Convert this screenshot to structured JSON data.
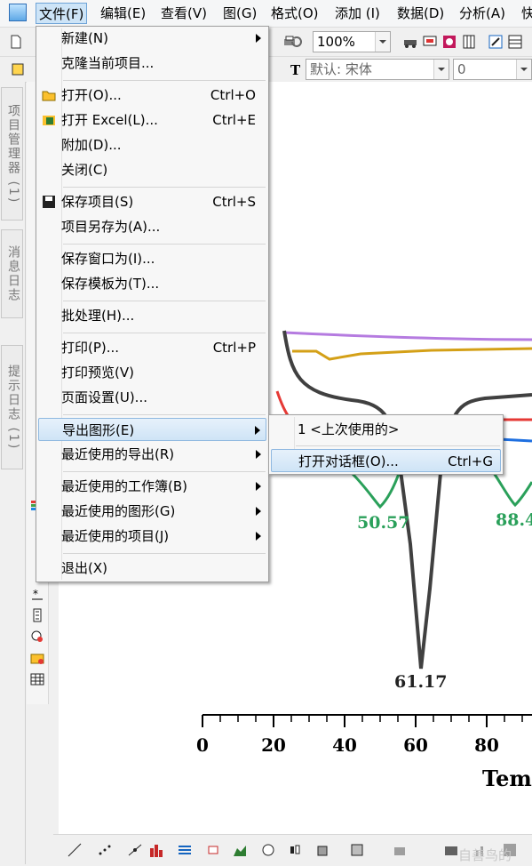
{
  "menubar": {
    "items": [
      "文件(F)",
      "编辑(E)",
      "查看(V)",
      "图(G)",
      "格式(O)",
      "添加 (I)",
      "数据(D)",
      "分析(A)",
      "快"
    ]
  },
  "toolbar1": {
    "zoom": "100%"
  },
  "toolbar2": {
    "font": "默认: 宋体",
    "size": "0"
  },
  "sidetabs": [
    "项目管理器 (1)",
    "消息日志",
    "提示日志 (1)"
  ],
  "file_menu": {
    "items": [
      {
        "label": "新建(N)",
        "shortcut": "",
        "submenu": true
      },
      {
        "label": "克隆当前项目...",
        "shortcut": "",
        "submenu": false
      },
      {
        "label": "打开(O)...",
        "shortcut": "Ctrl+O",
        "submenu": false
      },
      {
        "label": "打开 Excel(L)...",
        "shortcut": "Ctrl+E",
        "submenu": false
      },
      {
        "label": "附加(D)...",
        "shortcut": "",
        "submenu": false
      },
      {
        "label": "关闭(C)",
        "shortcut": "",
        "submenu": false
      },
      {
        "label": "保存项目(S)",
        "shortcut": "Ctrl+S",
        "submenu": false
      },
      {
        "label": "项目另存为(A)...",
        "shortcut": "",
        "submenu": false
      },
      {
        "label": "保存窗口为(I)...",
        "shortcut": "",
        "submenu": false
      },
      {
        "label": "保存模板为(T)...",
        "shortcut": "",
        "submenu": false
      },
      {
        "label": "批处理(H)...",
        "shortcut": "",
        "submenu": false
      },
      {
        "label": "打印(P)...",
        "shortcut": "Ctrl+P",
        "submenu": false
      },
      {
        "label": "打印预览(V)",
        "shortcut": "",
        "submenu": false
      },
      {
        "label": "页面设置(U)...",
        "shortcut": "",
        "submenu": false
      },
      {
        "label": "导出图形(E)",
        "shortcut": "",
        "submenu": true
      },
      {
        "label": "最近使用的导出(R)",
        "shortcut": "",
        "submenu": true
      },
      {
        "label": "最近使用的工作簿(B)",
        "shortcut": "",
        "submenu": true
      },
      {
        "label": "最近使用的图形(G)",
        "shortcut": "",
        "submenu": true
      },
      {
        "label": "最近使用的项目(J)",
        "shortcut": "",
        "submenu": true
      },
      {
        "label": "退出(X)",
        "shortcut": "",
        "submenu": false
      }
    ]
  },
  "export_submenu": {
    "items": [
      {
        "label": "1 <上次使用的>",
        "shortcut": ""
      },
      {
        "label": "打开对话框(O)...",
        "shortcut": "Ctrl+G"
      }
    ]
  },
  "chart_data": {
    "type": "line",
    "x_ticks": [
      "0",
      "20",
      "40",
      "60",
      "80"
    ],
    "xlabel": "Tem",
    "annotations": [
      "50.57",
      "61.17",
      "88.4"
    ],
    "colors": {
      "purple": "#b57be0",
      "gold": "#d4a017",
      "gray": "#404040",
      "red": "#e53935",
      "green": "#2aa05a",
      "blue": "#1e6fe0"
    }
  },
  "watermark": "自善鸟的"
}
